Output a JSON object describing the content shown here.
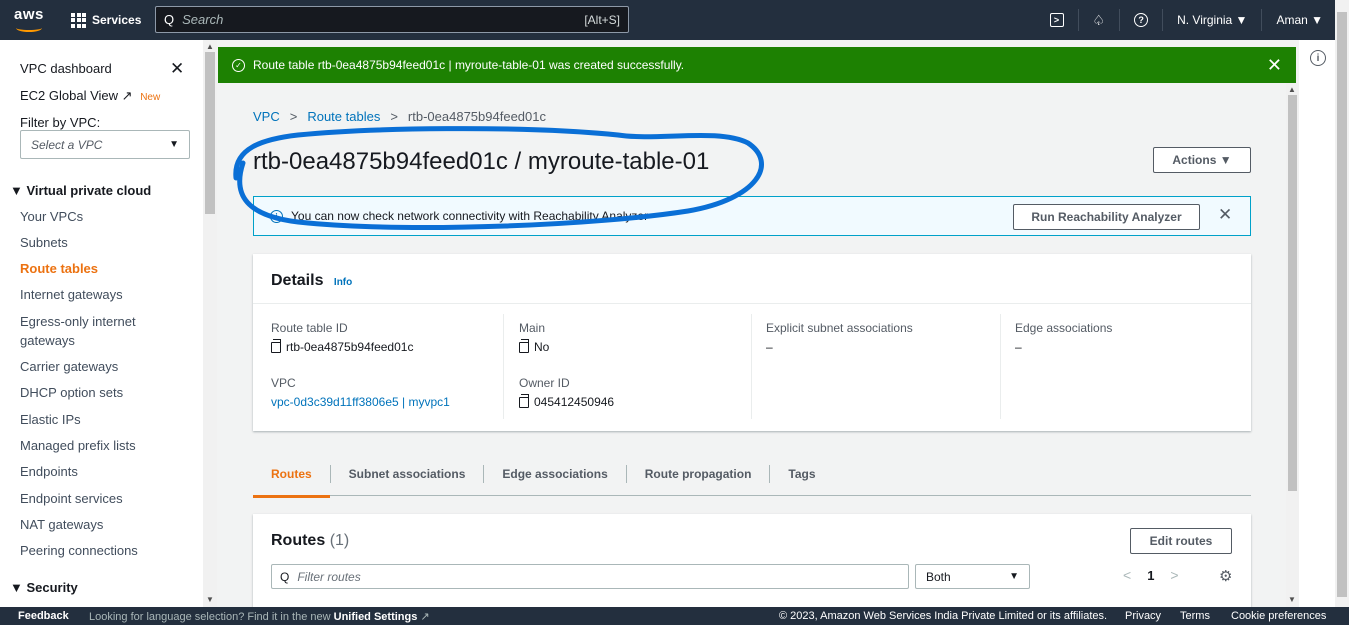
{
  "topnav": {
    "logo": "aws",
    "services": "Services",
    "search_placeholder": "Search",
    "search_shortcut": "[Alt+S]",
    "region": "N. Virginia ▼",
    "user": "Aman ▼"
  },
  "sidebar": {
    "dashboard": "VPC dashboard",
    "ec2_global": "EC2 Global View",
    "new_badge": "New",
    "filter_label": "Filter by VPC:",
    "select_placeholder": "Select a VPC",
    "section_vpc": "▼ Virtual private cloud",
    "items": [
      "Your VPCs",
      "Subnets",
      "Route tables",
      "Internet gateways",
      "Egress-only internet",
      "gateways",
      "Carrier gateways",
      "DHCP option sets",
      "Elastic IPs",
      "Managed prefix lists",
      "Endpoints",
      "Endpoint services",
      "NAT gateways",
      "Peering connections"
    ],
    "section_security": "▼ Security"
  },
  "banner": {
    "message": "Route table rtb-0ea4875b94feed01c | myroute-table-01 was created successfully."
  },
  "breadcrumb": {
    "vpc": "VPC",
    "route_tables": "Route tables",
    "current": "rtb-0ea4875b94feed01c"
  },
  "page": {
    "title": "rtb-0ea4875b94feed01c / myroute-table-01",
    "actions": "Actions ▼"
  },
  "infobar": {
    "message": "You can now check network connectivity with Reachability Analyzer",
    "button": "Run Reachability Analyzer"
  },
  "details": {
    "title": "Details",
    "info": "Info",
    "route_table_id_label": "Route table ID",
    "route_table_id": "rtb-0ea4875b94feed01c",
    "vpc_label": "VPC",
    "vpc": "vpc-0d3c39d11ff3806e5 | myvpc1",
    "main_label": "Main",
    "main": "No",
    "owner_label": "Owner ID",
    "owner": "045412450946",
    "explicit_label": "Explicit subnet associations",
    "explicit": "–",
    "edge_label": "Edge associations",
    "edge": "–"
  },
  "tabs": [
    "Routes",
    "Subnet associations",
    "Edge associations",
    "Route propagation",
    "Tags"
  ],
  "routes": {
    "title": "Routes",
    "count": "(1)",
    "edit": "Edit routes",
    "filter_placeholder": "Filter routes",
    "select_value": "Both",
    "page": "1"
  },
  "footer": {
    "feedback": "Feedback",
    "lang_text": "Looking for language selection? Find it in the new",
    "lang_link": "Unified Settings",
    "copyright": "© 2023, Amazon Web Services India Private Limited or its affiliates.",
    "privacy": "Privacy",
    "terms": "Terms",
    "cookies": "Cookie preferences"
  },
  "colors": {
    "nav": "#232f3e",
    "success": "#1d8102",
    "accent": "#ec7211",
    "link": "#0073bb",
    "annotation": "#0a6fd6"
  }
}
